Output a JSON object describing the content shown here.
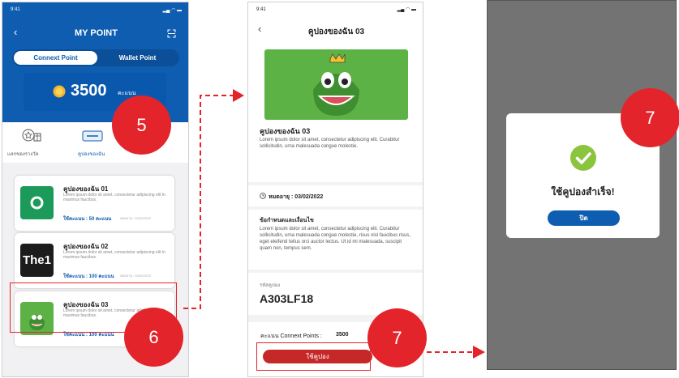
{
  "screen1": {
    "status_time": "9:41",
    "title": "MY POINT",
    "tabs": [
      "Connext Point",
      "Wallet Point"
    ],
    "points": "3500",
    "points_unit": "คะแนน",
    "quick_links": [
      "แลกของรางวัล",
      "คูปองของฉัน"
    ],
    "coupons": [
      {
        "title": "คูปองของฉัน 01",
        "desc": "Lorem ipsum dolor sit amet, consectetur adipiscing elit In maximus faucibus.",
        "points": "ใช้คะแนน : 50 คะแนน",
        "expiry": "หมดอายุ : 03/02/2022",
        "thumb": "starbucks"
      },
      {
        "title": "คูปองของฉัน 02",
        "desc": "Lorem ipsum dolor sit amet, consectetur adipiscing elit In maximus faucibus.",
        "points": "ใช้คะแนน : 100 คะแนน",
        "expiry": "หมดอายุ : 03/02/2022",
        "thumb": "The1"
      },
      {
        "title": "คูปองของฉัน 03",
        "desc": "Lorem ipsum dolor sit amet, consectetur adipiscing elit In maximus faucibus.",
        "points": "ใช้คะแนน : 100 คะแนน",
        "expiry": "",
        "thumb": "character"
      }
    ]
  },
  "screen2": {
    "status_time": "9:41",
    "title": "คูปองของฉัน 03",
    "coupon_name": "คูปองของฉัน 03",
    "coupon_desc": "Lorem ipsum dolor sit amet, consectetur adipiscing elit. Curabitur sollicitudin, urna malesuada congue molestie.",
    "expiry": "หมดอายุ : 03/02/2022",
    "terms_title": "ข้อกำหนดและเงื่อนไข",
    "terms_body": "Lorem ipsum dolor sit amet, consectetur adipiscing elit. Curabitur sollicitudin, urna malesuada congue molestie, risus nisl faucibus risus, eget eleifend tellus orci auctor lectus. Ut id mi malesuada, suscipit quam non, tempus sem.",
    "code_label": "รหัสคูปอง",
    "code": "A303LF18",
    "points_label": "คะแนน Connext Points :",
    "points_value": "3500",
    "use_button": "ใช้คูปอง"
  },
  "screen3": {
    "success_text": "ใช้คูปองสำเร็จ!",
    "close_button": "ปิด"
  },
  "badges": {
    "b5": "5",
    "b6": "6",
    "b7a": "7",
    "b7b": "7"
  },
  "colors": {
    "primary": "#0e5db0",
    "danger": "#e3242b",
    "button_red": "#c62828",
    "success": "#8bc53f"
  }
}
